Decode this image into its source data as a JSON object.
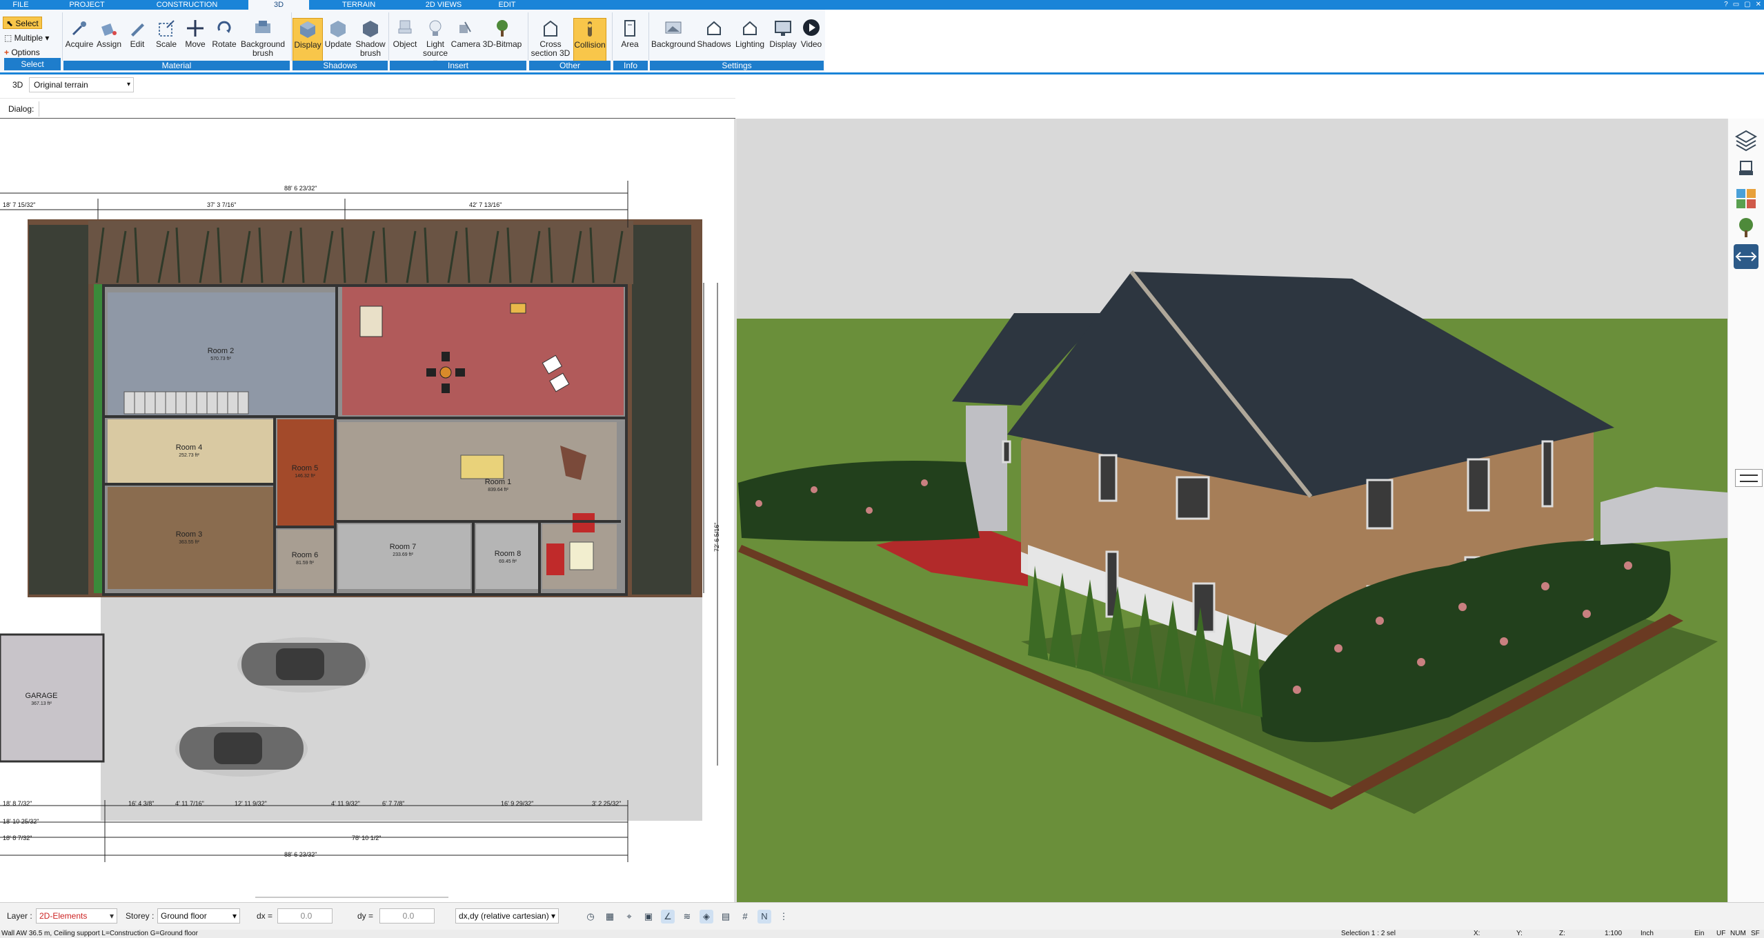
{
  "tabs": [
    {
      "label": "FILE"
    },
    {
      "label": "PROJECT"
    },
    {
      "label": "CONSTRUCTION"
    },
    {
      "label": "3D"
    },
    {
      "label": "TERRAIN"
    },
    {
      "label": "2D VIEWS"
    },
    {
      "label": "EDIT"
    }
  ],
  "window_controls": [
    "?",
    "▭",
    "▢",
    "✕"
  ],
  "ribbon": {
    "select": {
      "select_label": "Select",
      "multiple_label": "Multiple",
      "options_label": "Options",
      "group": "Select"
    },
    "material": {
      "group": "Material",
      "buttons": [
        {
          "label": "Acquire"
        },
        {
          "label": "Assign"
        },
        {
          "label": "Edit"
        },
        {
          "label": "Scale"
        },
        {
          "label": "Move"
        },
        {
          "label": "Rotate"
        },
        {
          "label": "Background brush"
        }
      ]
    },
    "shadows": {
      "group": "Shadows",
      "buttons": [
        {
          "label": "Display"
        },
        {
          "label": "Update"
        },
        {
          "label": "Shadow brush"
        }
      ]
    },
    "insert": {
      "group": "Insert",
      "buttons": [
        {
          "label": "Object"
        },
        {
          "label": "Light source"
        },
        {
          "label": "Camera"
        },
        {
          "label": "3D-Bitmap"
        }
      ]
    },
    "other": {
      "group": "Other",
      "buttons": [
        {
          "label": "Cross section 3D"
        },
        {
          "label": "Collision"
        }
      ]
    },
    "info": {
      "group": "Info",
      "buttons": [
        {
          "label": "Area"
        }
      ]
    },
    "settings": {
      "group": "Settings",
      "buttons": [
        {
          "label": "Background"
        },
        {
          "label": "Shadows"
        },
        {
          "label": "Lighting"
        },
        {
          "label": "Display"
        },
        {
          "label": "Video"
        }
      ]
    }
  },
  "view_mode": {
    "label": "3D",
    "value": "Original terrain"
  },
  "dialog_label": "Dialog:",
  "plan": {
    "rooms": [
      {
        "name": "Room 2",
        "area": "570.73 ft²"
      },
      {
        "name": "Room 4",
        "area": "252.73 ft²"
      },
      {
        "name": "Room 3",
        "area": "363.55 ft²"
      },
      {
        "name": "Room 1",
        "area": "839.64 ft²"
      },
      {
        "name": "Room 5",
        "area": "146.32 ft²"
      },
      {
        "name": "Room 6",
        "area": "81.59 ft²"
      },
      {
        "name": "Room 7",
        "area": "233.69 ft²"
      },
      {
        "name": "Room 8",
        "area": "69.45 ft²"
      },
      {
        "name": "GARAGE",
        "area": "367.13 ft²"
      }
    ],
    "dims": {
      "top_total": "88' 6 23/32\"",
      "top_left": "37' 3 7/16\"",
      "top_right": "42' 7 13/16\"",
      "top_edge": "18' 7 15/32\"",
      "bottom_total": "88' 6 23/32\"",
      "bottom_mid": "78' 10 1/2\"",
      "bottom_row": [
        "18' 8 7/32\"",
        "16' 4 3/8\"",
        "4' 11 7/16\"",
        "12' 11 9/32\"",
        "4' 11 9/32\"",
        "6' 7 7/8\"",
        "16' 9 29/32\"",
        "3' 2 25/32\""
      ],
      "left_row": [
        "18' 10 25/32\"",
        "18' 8 7/32\""
      ],
      "right_side": "72' 6 5/16\""
    }
  },
  "status": {
    "layer_label": "Layer :",
    "layer_value": "2D-Elements",
    "storey_label": "Storey :",
    "storey_value": "Ground floor",
    "dx_label": "dx =",
    "dx_value": "0.0",
    "dy_label": "dy =",
    "dy_value": "0.0",
    "coord_mode": "dx,dy (relative cartesian)"
  },
  "info": {
    "message": "Wall AW 36.5 m, Ceiling support L=Construction G=Ground floor",
    "selection": "Selection 1 : 2 sel",
    "x_label": "X:",
    "y_label": "Y:",
    "z_label": "Z:",
    "scale": "1:100",
    "unit": "Inch",
    "ein": "Ein",
    "uf": "UF",
    "num": "NUM",
    "sf": "SF"
  },
  "colors": {
    "accent": "#1a84d8",
    "ribbon_bg": "#f4f7fb",
    "active_btn": "#f8c64a",
    "layer_value": "#cc2222",
    "grass": "#6a8f3a",
    "roof": "#2d3640"
  }
}
